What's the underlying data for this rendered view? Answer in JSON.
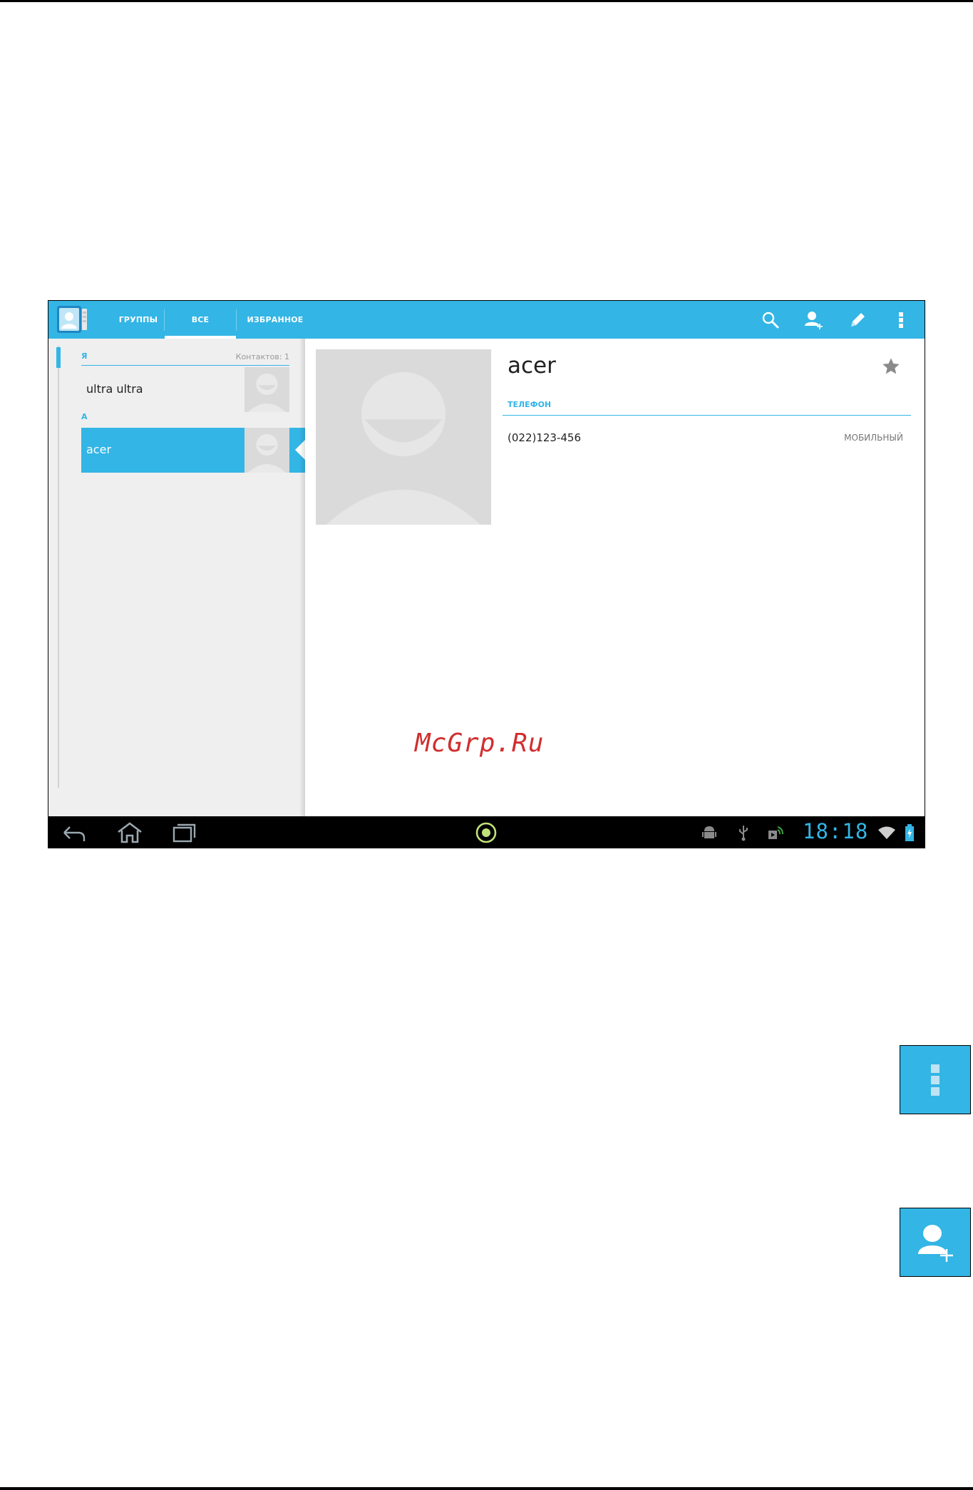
{
  "app": {
    "tabs": [
      {
        "label": "ГРУППЫ"
      },
      {
        "label": "ВСЕ"
      },
      {
        "label": "ИЗБРАННОЕ"
      }
    ],
    "actions": [
      "search-icon",
      "add-contact-icon",
      "edit-icon",
      "overflow-menu-icon"
    ]
  },
  "list": {
    "sections": [
      {
        "header": "Я",
        "count_label": "Контактов: 1"
      },
      {
        "header": "А"
      }
    ],
    "contacts": [
      {
        "name": "ultra ultra",
        "selected": false
      },
      {
        "name": "acer",
        "selected": true
      }
    ]
  },
  "detail": {
    "name": "acer",
    "section_label": "ТЕЛЕФОН",
    "phone": "(022)123-456",
    "phone_type": "МОБИЛЬНЫЙ"
  },
  "watermark": "McGrp.Ru",
  "status_bar": {
    "clock": "18:18"
  },
  "colors": {
    "accent": "#33b5e5",
    "panel": "#efefef",
    "navbar": "#000000"
  }
}
